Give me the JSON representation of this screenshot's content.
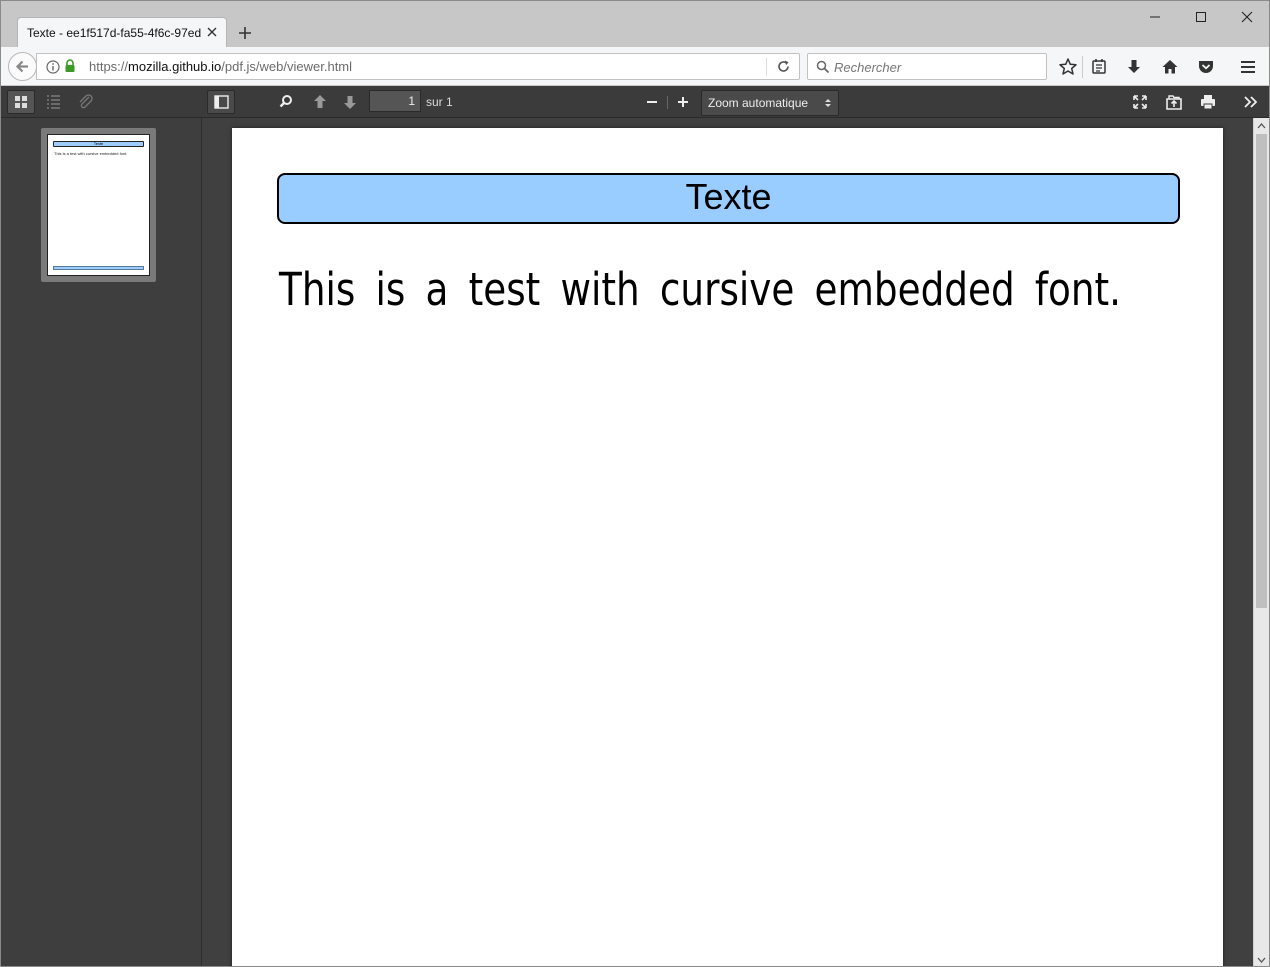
{
  "browser": {
    "tab_title": "Texte - ee1f517d-fa55-4f6c-97ed",
    "url_scheme": "https://",
    "url_host": "mozilla.github.io",
    "url_path": "/pdf.js/web/viewer.html",
    "search_placeholder": "Rechercher"
  },
  "viewer": {
    "page_number": "1",
    "page_count_label": "sur 1",
    "zoom_label": "Zoom automatique"
  },
  "pdf_page": {
    "header_text": "Texte",
    "body_text": "This is a test with cursive embedded font."
  },
  "thumbnail": {
    "header_text": "Texte",
    "body_text": "This is a test with cursive embedded font."
  },
  "colors": {
    "header_fill": "#99ccff",
    "toolbar_bg": "#3b3b3b",
    "viewer_bg": "#404040",
    "lock_green": "#3a9b27"
  }
}
